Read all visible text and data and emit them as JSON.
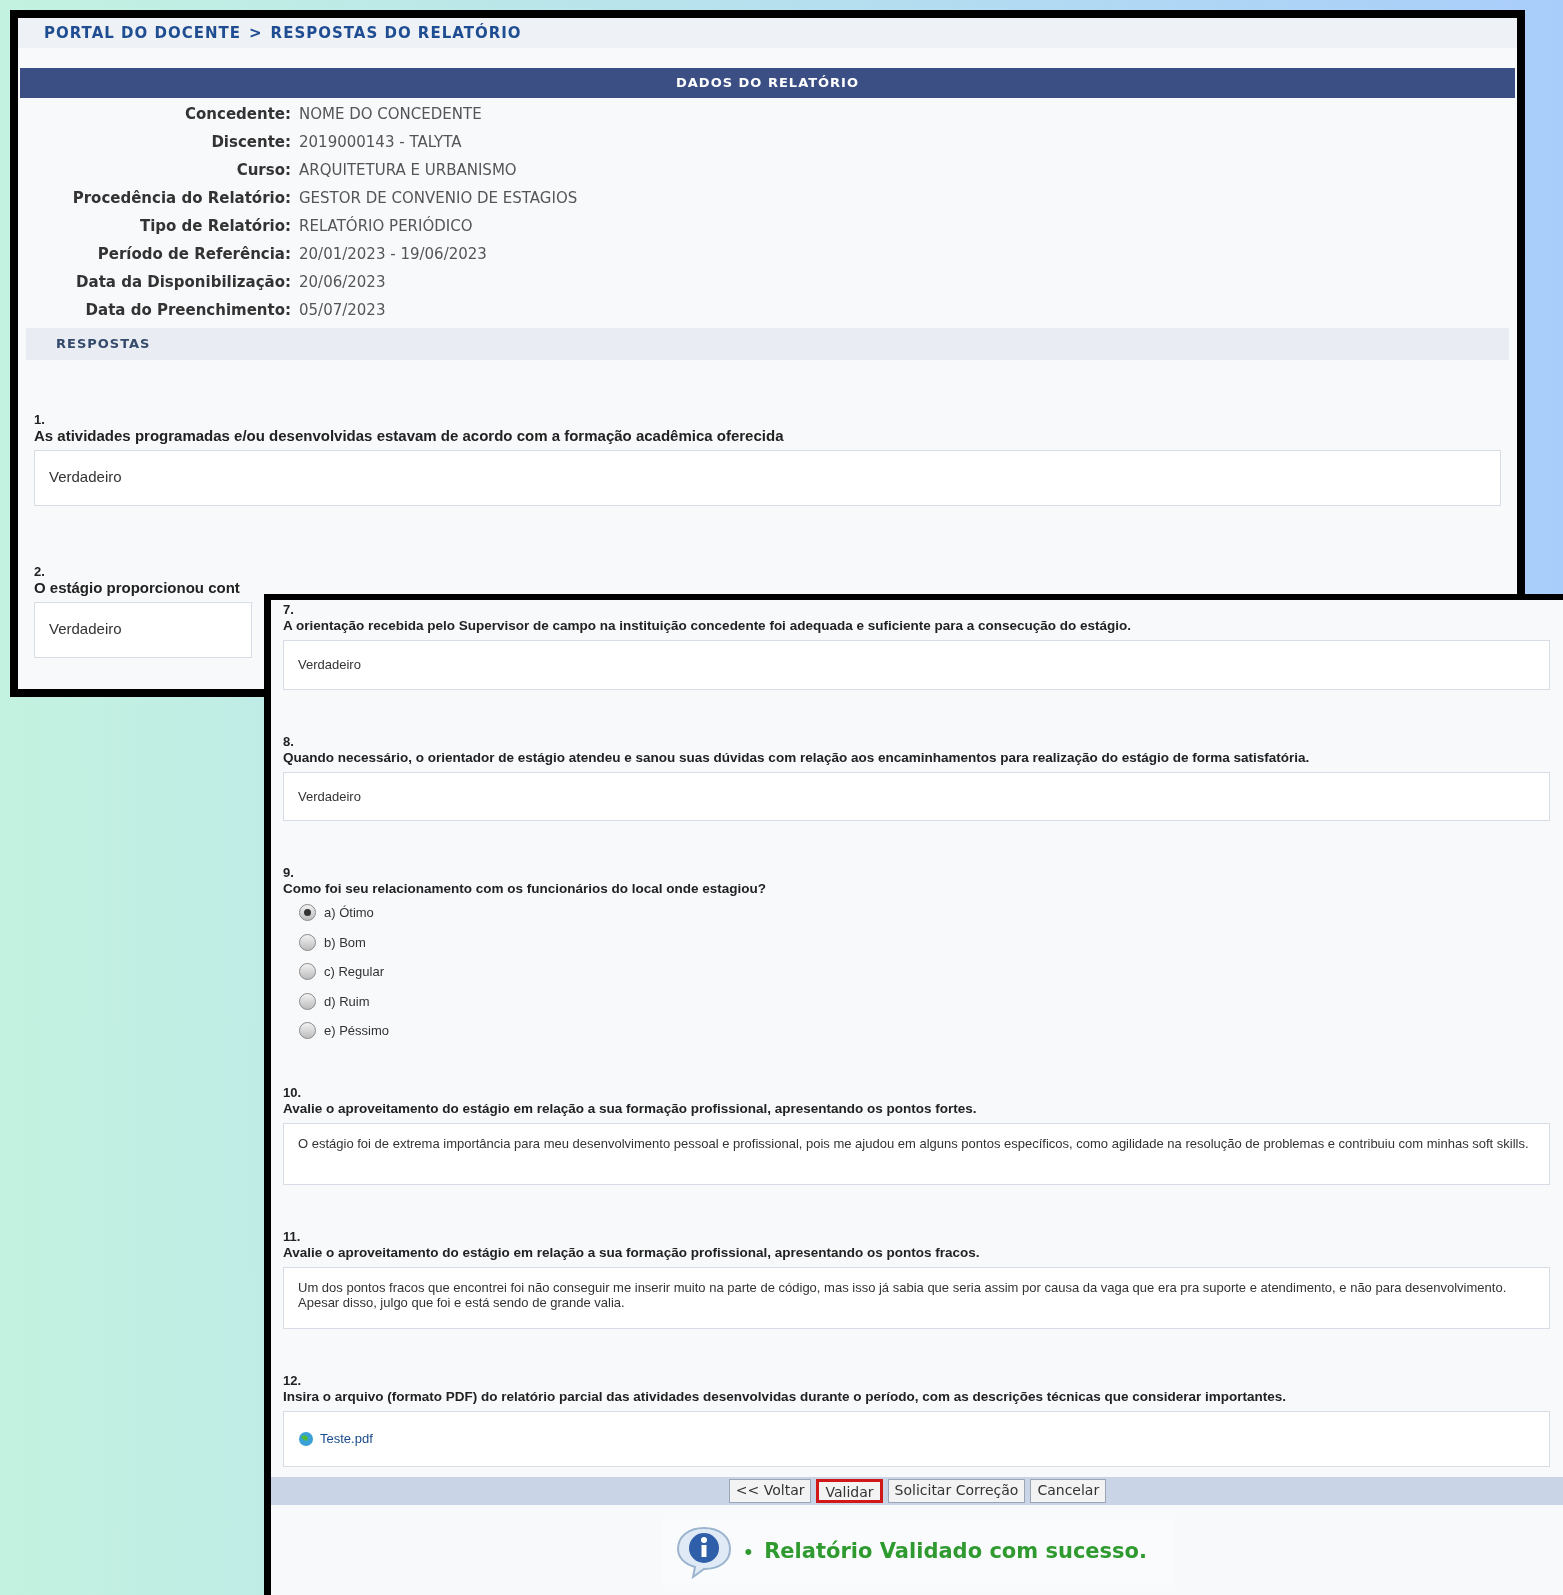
{
  "report_window": {
    "breadcrumb": {
      "first": "PORTAL DO DOCENTE",
      "separator": ">",
      "second": "RESPOSTAS DO RELATÓRIO"
    },
    "section_title": "DADOS DO RELATÓRIO",
    "fields": [
      {
        "label": "Concedente:",
        "value": "NOME DO CONCEDENTE"
      },
      {
        "label": "Discente:",
        "value": "2019000143 - TALYTA"
      },
      {
        "label": "Curso:",
        "value": "ARQUITETURA E URBANISMO"
      },
      {
        "label": "Procedência do Relatório:",
        "value": "GESTOR DE CONVENIO DE ESTAGIOS"
      },
      {
        "label": "Tipo de Relatório:",
        "value": "RELATÓRIO PERIÓDICO"
      },
      {
        "label": "Período de Referência:",
        "value": "20/01/2023 - 19/06/2023"
      },
      {
        "label": "Data da Disponibilização:",
        "value": "20/06/2023"
      },
      {
        "label": "Data do Preenchimento:",
        "value": "05/07/2023"
      }
    ],
    "answers_title": "RESPOSTAS",
    "questions": [
      {
        "kind": "text",
        "number": "1.",
        "question": "As atividades programadas e/ou desenvolvidas estavam de acordo com a formação acadêmica oferecida",
        "answer": "Verdadeiro"
      },
      {
        "kind": "text",
        "number": "2.",
        "question": "O estágio proporcionou cont",
        "answer": "Verdadeiro"
      }
    ]
  },
  "answers_window": {
    "questions": [
      {
        "kind": "text",
        "number": "7.",
        "question": "A orientação recebida pelo Supervisor de campo na instituição concedente foi adequada e suficiente para a consecução do estágio.",
        "answer": "Verdadeiro"
      },
      {
        "kind": "text",
        "number": "8.",
        "question": "Quando necessário, o orientador de estágio atendeu e sanou suas dúvidas com relação aos encaminhamentos para realização do estágio de forma satisfatória.",
        "answer": "Verdadeiro"
      },
      {
        "kind": "radio",
        "number": "9.",
        "question": "Como foi seu relacionamento com os funcionários do local onde estagiou?",
        "options": [
          {
            "label": "a) Ótimo",
            "selected": true
          },
          {
            "label": "b) Bom",
            "selected": false
          },
          {
            "label": "c) Regular",
            "selected": false
          },
          {
            "label": "d) Ruim",
            "selected": false
          },
          {
            "label": "e) Péssimo",
            "selected": false
          }
        ]
      },
      {
        "kind": "text",
        "number": "10.",
        "question": "Avalie o aproveitamento do estágio em relação a sua formação profissional, apresentando os pontos fortes.",
        "answer": "O estágio foi de extrema importância para meu desenvolvimento pessoal e profissional, pois me ajudou em alguns pontos específicos, como agilidade na resolução de problemas e contribuiu com minhas soft skills."
      },
      {
        "kind": "text",
        "number": "11.",
        "question": "Avalie o aproveitamento do estágio em relação a sua formação profissional, apresentando os pontos fracos.",
        "answer": "Um dos pontos fracos que encontrei foi não conseguir me inserir muito na parte de código, mas isso já sabia que seria assim por causa da vaga que era pra suporte e atendimento, e não para desenvolvimento. Apesar disso, julgo que foi e está sendo de grande valia."
      },
      {
        "kind": "file",
        "number": "12.",
        "question": "Insira o arquivo (formato PDF) do relatório parcial das atividades desenvolvidas durante o período, com as descrições técnicas que considerar importantes.",
        "file": "Teste.pdf"
      }
    ],
    "buttons": [
      {
        "label": "<< Voltar",
        "highlighted": false
      },
      {
        "label": "Validar",
        "highlighted": true
      },
      {
        "label": "Solicitar Correção",
        "highlighted": false
      },
      {
        "label": "Cancelar",
        "highlighted": false
      }
    ],
    "message": {
      "bullet": "•",
      "text": "Relatório Validado com sucesso."
    }
  }
}
